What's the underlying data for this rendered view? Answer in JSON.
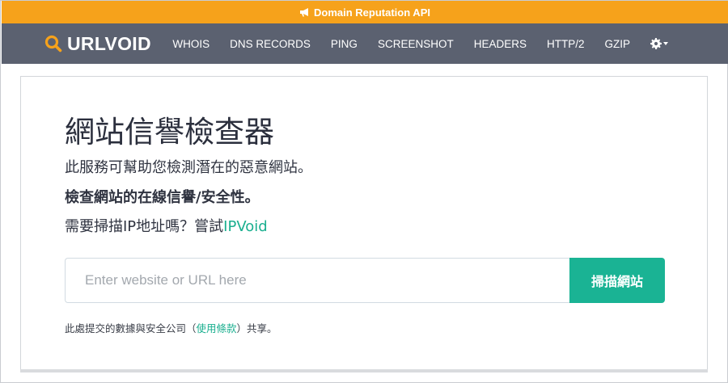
{
  "promo": {
    "label": "Domain Reputation API",
    "icon": "megaphone-icon"
  },
  "brand": {
    "name": "URLVOID",
    "icon": "magnifier-icon",
    "accent": "#f6a21b"
  },
  "nav": {
    "items": [
      {
        "label": "WHOIS"
      },
      {
        "label": "DNS RECORDS"
      },
      {
        "label": "PING"
      },
      {
        "label": "SCREENSHOT"
      },
      {
        "label": "HEADERS"
      },
      {
        "label": "HTTP/2"
      },
      {
        "label": "GZIP"
      }
    ],
    "settings_icon": "gear-icon"
  },
  "main": {
    "title": "網站信譽檢查器",
    "tagline": "此服務可幫助您檢測潛在的惡意網站。",
    "subtagline": "檢查網站的在線信譽/安全性。",
    "ip_prompt_prefix": "需要掃描IP地址嗎？嘗試",
    "ip_link": "IPVoid",
    "search": {
      "placeholder": "Enter website or URL here",
      "value": "",
      "button_label": "掃描網站"
    },
    "disclaimer_prefix": "此處提交的數據與安全公司（",
    "disclaimer_link": "使用條款",
    "disclaimer_suffix": "）共享。"
  },
  "colors": {
    "promo_bg": "#f6a21b",
    "nav_bg": "#5b6170",
    "button_bg": "#1ab394",
    "link": "#1aaf8f"
  }
}
